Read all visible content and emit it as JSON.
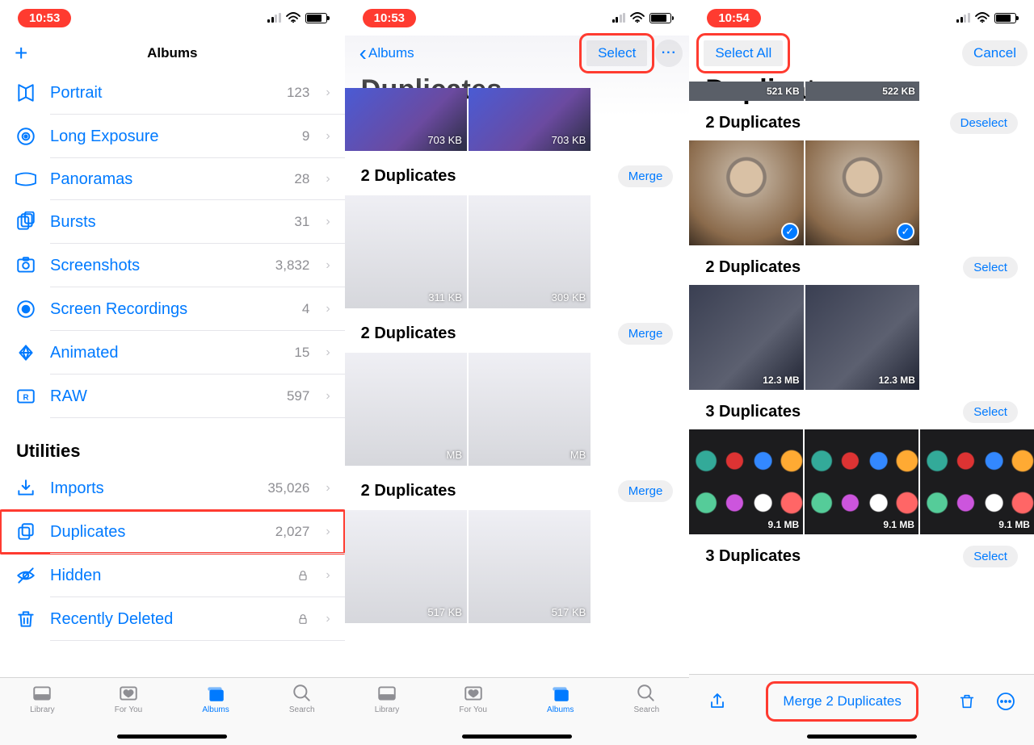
{
  "status": {
    "time1": "10:53",
    "time2": "10:53",
    "time3": "10:54"
  },
  "phone1": {
    "title": "Albums",
    "mediaTypes": [
      {
        "icon": "portrait",
        "label": "Portrait",
        "count": "123"
      },
      {
        "icon": "long-exposure",
        "label": "Long Exposure",
        "count": "9"
      },
      {
        "icon": "panorama",
        "label": "Panoramas",
        "count": "28"
      },
      {
        "icon": "bursts",
        "label": "Bursts",
        "count": "31"
      },
      {
        "icon": "screenshots",
        "label": "Screenshots",
        "count": "3,832"
      },
      {
        "icon": "screen-rec",
        "label": "Screen Recordings",
        "count": "4"
      },
      {
        "icon": "animated",
        "label": "Animated",
        "count": "15"
      },
      {
        "icon": "raw",
        "label": "RAW",
        "count": "597"
      }
    ],
    "utilitiesTitle": "Utilities",
    "utilities": [
      {
        "icon": "imports",
        "label": "Imports",
        "count": "35,026",
        "lock": false,
        "highlight": false
      },
      {
        "icon": "duplicates",
        "label": "Duplicates",
        "count": "2,027",
        "lock": false,
        "highlight": true
      },
      {
        "icon": "hidden",
        "label": "Hidden",
        "count": "",
        "lock": true,
        "highlight": false
      },
      {
        "icon": "trash",
        "label": "Recently Deleted",
        "count": "",
        "lock": true,
        "highlight": false
      }
    ],
    "tabs": [
      "Library",
      "For You",
      "Albums",
      "Search"
    ]
  },
  "phone2": {
    "back": "Albums",
    "title": "Duplicates",
    "select": "Select",
    "topPair": [
      "703 KB",
      "703 KB"
    ],
    "groups": [
      {
        "title": "2 Duplicates",
        "btn": "Merge",
        "sizes": [
          "311 KB",
          "309 KB"
        ],
        "style": "light"
      },
      {
        "title": "2 Duplicates",
        "btn": "Merge",
        "sizes": [
          "MB",
          "MB"
        ],
        "style": "light"
      },
      {
        "title": "2 Duplicates",
        "btn": "Merge",
        "sizes": [
          "517 KB",
          "517 KB"
        ],
        "style": "light"
      }
    ],
    "tabs": [
      "Library",
      "For You",
      "Albums",
      "Search"
    ]
  },
  "phone3": {
    "selectAll": "Select All",
    "cancel": "Cancel",
    "title": "Duplicates",
    "topPair": [
      "521 KB",
      "522 KB"
    ],
    "groups": [
      {
        "title": "2 Duplicates",
        "btn": "Deselect",
        "sizes": [
          "",
          ""
        ],
        "style": "portrait",
        "checked": true
      },
      {
        "title": "2 Duplicates",
        "btn": "Select",
        "sizes": [
          "12.3 MB",
          "12.3 MB"
        ],
        "style": "dark"
      },
      {
        "title": "3 Duplicates",
        "btn": "Select",
        "sizes": [
          "9.1 MB",
          "9.1 MB",
          "9.1 MB"
        ],
        "style": "icons"
      },
      {
        "title": "3 Duplicates",
        "btn": "Select",
        "sizes": [],
        "style": "none"
      }
    ],
    "merge": "Merge 2 Duplicates"
  }
}
